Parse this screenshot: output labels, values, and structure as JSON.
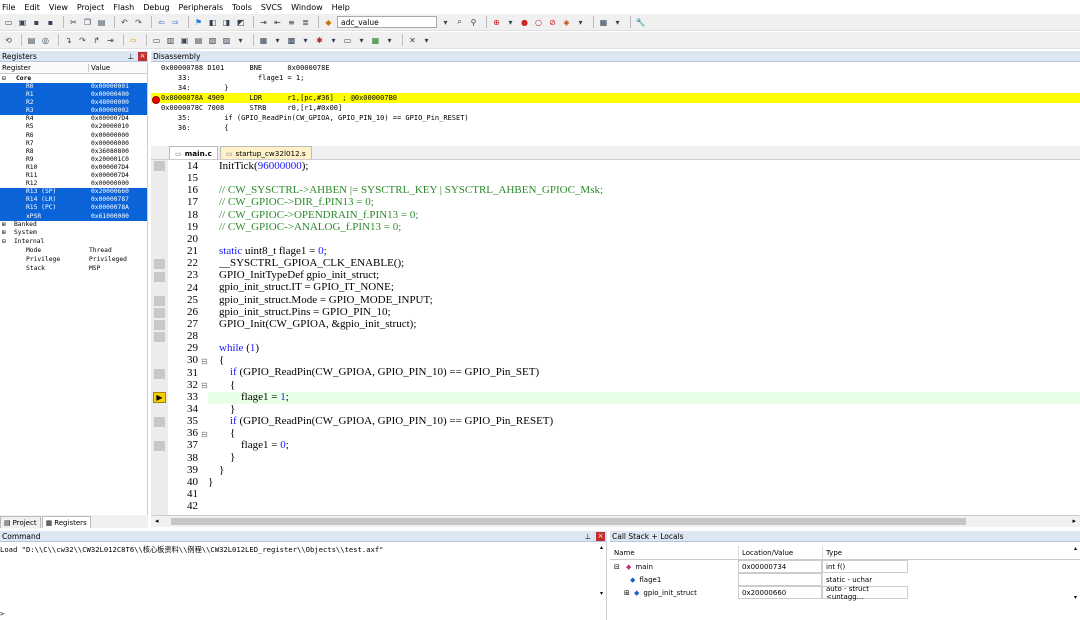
{
  "menu": [
    "File",
    "Edit",
    "View",
    "Project",
    "Flash",
    "Debug",
    "Peripherals",
    "Tools",
    "SVCS",
    "Window",
    "Help"
  ],
  "toolbar": {
    "target_combo": "adc_value"
  },
  "registers": {
    "title": "Registers",
    "col_register": "Register",
    "col_value": "Value",
    "core_label": "Core",
    "rows": [
      {
        "name": "R0",
        "value": "0x00000001",
        "selected": true
      },
      {
        "name": "R1",
        "value": "0x00000400",
        "selected": true
      },
      {
        "name": "R2",
        "value": "0x48000000",
        "selected": true
      },
      {
        "name": "R3",
        "value": "0x00000002",
        "selected": true
      },
      {
        "name": "R4",
        "value": "0x000007D4",
        "selected": false
      },
      {
        "name": "R5",
        "value": "0x20000010",
        "selected": false
      },
      {
        "name": "R6",
        "value": "0x00000000",
        "selected": false
      },
      {
        "name": "R7",
        "value": "0x00000000",
        "selected": false
      },
      {
        "name": "R8",
        "value": "0x36080800",
        "selected": false
      },
      {
        "name": "R9",
        "value": "0x200001C0",
        "selected": false
      },
      {
        "name": "R10",
        "value": "0x000007D4",
        "selected": false
      },
      {
        "name": "R11",
        "value": "0x000007D4",
        "selected": false
      },
      {
        "name": "R12",
        "value": "0x00000000",
        "selected": false
      },
      {
        "name": "R13 (SP)",
        "value": "0x20000660",
        "selected": true
      },
      {
        "name": "R14 (LR)",
        "value": "0x00000787",
        "selected": true
      },
      {
        "name": "R15 (PC)",
        "value": "0x0000078A",
        "selected": true
      },
      {
        "name": "xPSR",
        "value": "0x61000000",
        "selected": true
      }
    ],
    "groups": [
      "Banked",
      "System",
      "Internal"
    ],
    "internal": [
      {
        "name": "Mode",
        "value": "Thread"
      },
      {
        "name": "Privilege",
        "value": "Privileged"
      },
      {
        "name": "Stack",
        "value": "MSP"
      }
    ],
    "tab_project": "Project",
    "tab_registers": "Registers"
  },
  "disassembly": {
    "title": "Disassembly",
    "lines": [
      {
        "text": "0x00000788 D101      BNE      0x0000078E",
        "hl": false
      },
      {
        "text": "    33:                flage1 = 1;",
        "hl": false
      },
      {
        "text": "    34:        }",
        "hl": false
      },
      {
        "text": "0x0000078A 4909      LDR      r1,[pc,#36]  ; @0x000007B0",
        "hl": true
      },
      {
        "text": "0x0000078C 7008      STRB     r0,[r1,#0x00]",
        "hl": false
      },
      {
        "text": "    35:        if (GPIO_ReadPin(CW_GPIOA, GPIO_PIN_10) == GPIO_Pin_RESET)",
        "hl": false
      },
      {
        "text": "    36:        {",
        "hl": false
      }
    ]
  },
  "editor": {
    "tabs": [
      "main.c",
      "startup_cw32l012.s"
    ],
    "line_numbers": [
      "14",
      "15",
      "16",
      "17",
      "18",
      "19",
      "20",
      "21",
      "22",
      "23",
      "24",
      "25",
      "26",
      "27",
      "28",
      "29",
      "30",
      "31",
      "32",
      "33",
      "34",
      "35",
      "36",
      "37",
      "38",
      "39",
      "40",
      "41",
      "42"
    ],
    "lines": [
      "    InitTick(96000000);",
      "",
      "    // CW_SYSCTRL->AHBEN |= SYSCTRL_KEY | SYSCTRL_AHBEN_GPIOC_Msk;",
      "    // CW_GPIOC->DIR_f.PIN13 = 0;",
      "    // CW_GPIOC->OPENDRAIN_f.PIN13 = 0;",
      "    // CW_GPIOC->ANALOG_f.PIN13 = 0;",
      "",
      "    static uint8_t flage1 = 0;",
      "    __SYSCTRL_GPIOA_CLK_ENABLE();",
      "    GPIO_InitTypeDef gpio_init_struct;",
      "    gpio_init_struct.IT = GPIO_IT_NONE;",
      "    gpio_init_struct.Mode = GPIO_MODE_INPUT;",
      "    gpio_init_struct.Pins = GPIO_PIN_10;",
      "    GPIO_Init(CW_GPIOA, &gpio_init_struct);",
      "",
      "    while (1)",
      "    {",
      "        if (GPIO_ReadPin(CW_GPIOA, GPIO_PIN_10) == GPIO_Pin_SET)",
      "        {",
      "            flage1 = 1;",
      "        }",
      "        if (GPIO_ReadPin(CW_GPIOA, GPIO_PIN_10) == GPIO_Pin_RESET)",
      "        {",
      "            flage1 = 0;",
      "        }",
      "    }",
      "}",
      "",
      ""
    ]
  },
  "command": {
    "title": "Command",
    "text": "Load \"D:\\\\C\\\\cw32\\\\CW32L012C8T6\\\\核心板资料\\\\例程\\\\CW32L012LED_register\\\\Objects\\\\test.axf\"",
    "prompt": ">"
  },
  "callstack": {
    "title": "Call Stack + Locals",
    "col_name": "Name",
    "col_location": "Location/Value",
    "col_type": "Type",
    "rows": [
      {
        "name": "main",
        "location": "0x00000734",
        "type": "int f()"
      },
      {
        "name": "flage1",
        "location": "",
        "type": "static - uchar"
      },
      {
        "name": "gpio_init_struct",
        "location": "0x20000660",
        "type": "auto - struct <untagg..."
      }
    ]
  }
}
